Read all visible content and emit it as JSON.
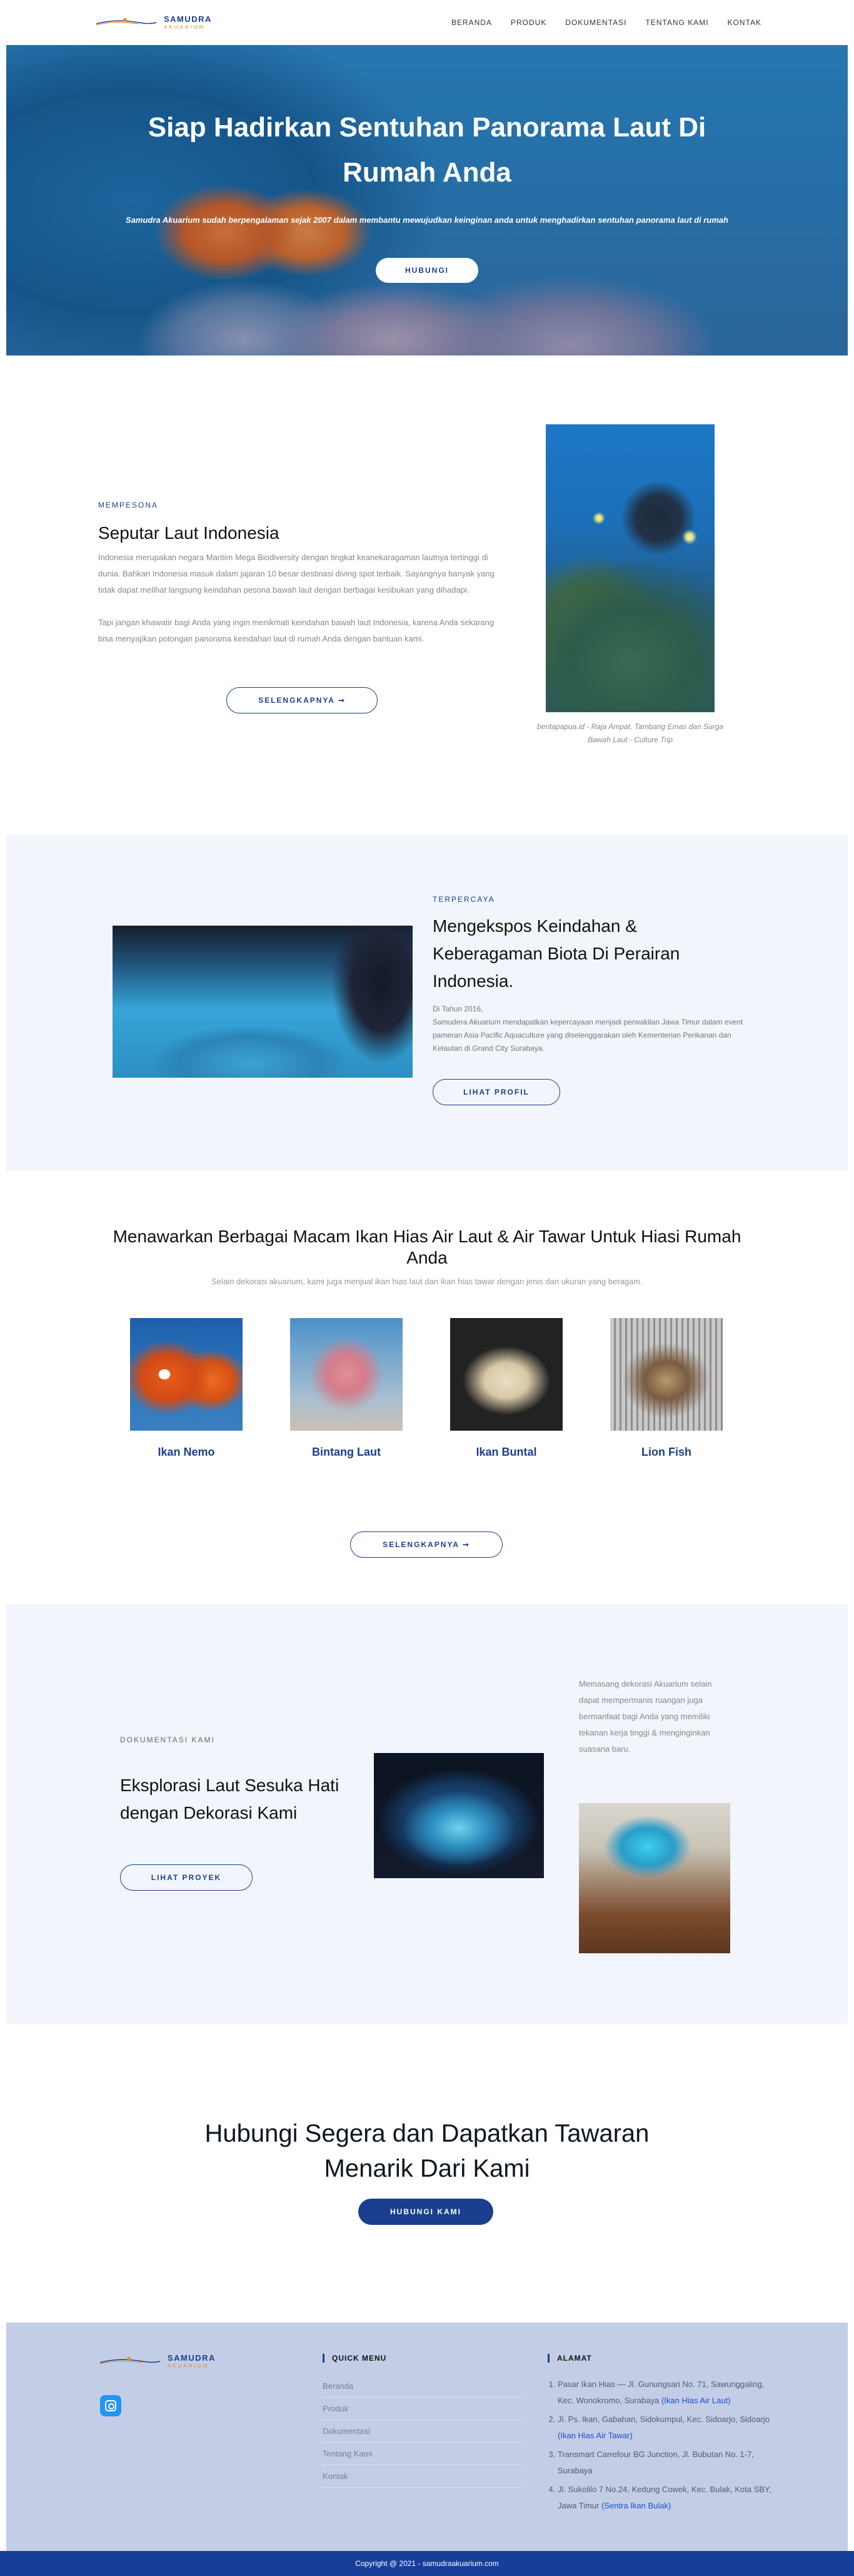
{
  "brand": {
    "name": "SAMUDRA",
    "sub": "AKUARIUM"
  },
  "nav": [
    "BERANDA",
    "PRODUK",
    "DOKUMENTASI",
    "TENTANG KAMI",
    "KONTAK"
  ],
  "hero": {
    "title": "Siap Hadirkan Sentuhan Panorama Laut Di Rumah Anda",
    "subtitle": "Samudra Akuarium sudah berpengalaman sejak 2007 dalam membantu mewujudkan keinginan anda untuk menghadirkan sentuhan panorama laut di rumah",
    "button": "HUBUNGI"
  },
  "laut": {
    "kicker": "MEMPESONA",
    "title": "Seputar Laut Indonesia",
    "p1": "Indonesia merupakan negara Maritim Mega Biodiversity dengan tingkat keanekaragaman lautnya tertinggi di dunia. Bahkan Indonesia masuk dalam jajaran 10 besar destinasi diving spot terbaik. Sayangnya banyak yang tidak dapat melihat langsung keindahan pesona bawah laut dengan berbagai kesibukan yang dihadapi.",
    "p2": "Tapi jangan khawatir bagi Anda yang ingin menikmati keindahan bawah laut Indonesia, karena Anda sekarang bisa menyajikan potongan panorama keindahan laut di rumah Anda dengan bantuan kami.",
    "button": "SELENGKAPNYA ➞",
    "caption": "beritapapua.id - Raja Ampat, Tambang Emas dan Surga Bawah Laut - Culture Trip"
  },
  "trust": {
    "kicker": "TERPERCAYA",
    "title": "Mengekspos Keindahan & Keberagaman Biota Di Perairan Indonesia.",
    "line1": "Di Tahun 2016,",
    "line2": "Samudera Akuarium mendapatkan kepercayaan menjadi perwakilan Jawa Timur dalam event pameran Asia Pacific Aquaculture yang diselenggarakan oleh Kementerian Perikanan dan Kelautan di Grand City Surabaya.",
    "button": "LIHAT PROFIL"
  },
  "produk": {
    "title": "Menawarkan Berbagai Macam Ikan Hias Air Laut & Air Tawar Untuk Hiasi Rumah Anda",
    "subtitle": "Selain dekorasi akuarium, kami juga menjual ikan hias laut dan ikan hias tawar dengan jenis dan ukuran yang beragam.",
    "items": [
      "Ikan Nemo",
      "Bintang Laut",
      "Ikan Buntal",
      "Lion Fish"
    ],
    "button": "SELENGKAPNYA ➞"
  },
  "dokumentasi": {
    "kicker": "DOKUMENTASI KAMI",
    "title": "Eksplorasi Laut Sesuka Hati dengan Dekorasi Kami",
    "button": "LIHAT PROYEK",
    "side_text": "Memasang dekorasi Akuarium selain dapat mempermanis ruangan juga bermanfaat bagi Anda yang memiliki tekanan kerja tinggi & menginginkan suasana baru."
  },
  "cta": {
    "title": "Hubungi Segera dan Dapatkan Tawaran Menarik Dari Kami",
    "button": "HUBUNGI KAMI"
  },
  "footer": {
    "quick_title": "QUICK MENU",
    "quick": [
      "Beranda",
      "Produk",
      "Dokumentasi",
      "Tentang Kami",
      "Kontak"
    ],
    "addr_title": "ALAMAT",
    "addr": [
      {
        "text": "Pasar Ikan Hias — Jl. Gunungsari No. 71, Sawunggaling, Kec. Wonokromo, Surabaya ",
        "link": "(Ikan Hias Air Laut)"
      },
      {
        "text": "Jl. Ps. Ikan, Gabahan, Sidokumpul, Kec. Sidoarjo, Sidoarjo ",
        "link": "(Ikan Hias Air Tawar)"
      },
      {
        "text": "Transmart Carrefour BG Junction, Jl. Bubutan No. 1-7, Surabaya",
        "link": ""
      },
      {
        "text": "Jl. Sukolilo 7 No.24, Kedung Cowek, Kec. Bulak, Kota SBY, Jawa Timur ",
        "link": "(Sentra Ikan Bulak)"
      }
    ],
    "copyright": "Copyright @ 2021 - samudraakuarium.com"
  }
}
